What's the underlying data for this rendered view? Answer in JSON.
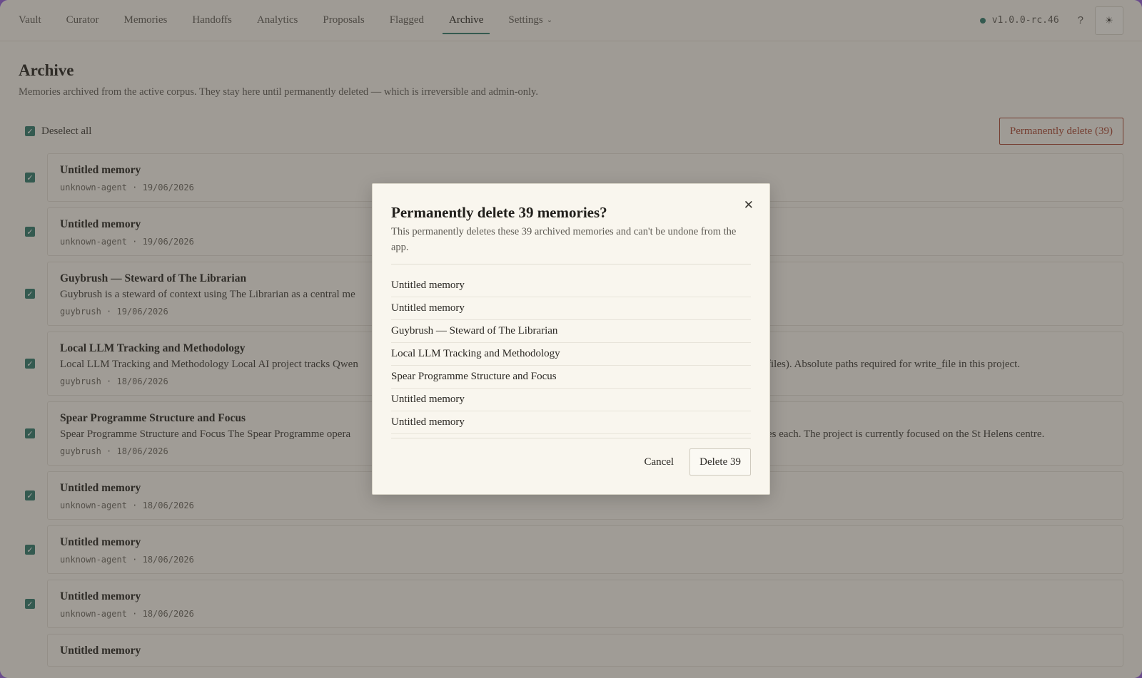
{
  "nav": {
    "tabs": [
      {
        "label": "Vault"
      },
      {
        "label": "Curator"
      },
      {
        "label": "Memories"
      },
      {
        "label": "Handoffs"
      },
      {
        "label": "Analytics"
      },
      {
        "label": "Proposals"
      },
      {
        "label": "Flagged"
      },
      {
        "label": "Archive",
        "active": true
      },
      {
        "label": "Settings",
        "has_dropdown": true
      }
    ],
    "version": "v1.0.0-rc.46",
    "help_label": "?",
    "theme_icon": "sun-icon",
    "status_color": "#2f7a6a"
  },
  "page": {
    "title": "Archive",
    "description": "Memories archived from the active corpus. They stay here until permanently deleted — which is irreversible and admin-only.",
    "deselect_label": "Deselect all",
    "perm_delete_label": "Permanently delete (39)"
  },
  "rows": [
    {
      "title": "Untitled memory",
      "body": "",
      "meta": "unknown-agent · 19/06/2026"
    },
    {
      "title": "Untitled memory",
      "body": "",
      "meta": "unknown-agent · 19/06/2026"
    },
    {
      "title": "Guybrush — Steward of The Librarian",
      "body": "Guybrush is a steward of context using The Librarian as a central me",
      "meta": "guybrush · 19/06/2026"
    },
    {
      "title": "Local LLM Tracking and Methodology",
      "body": "Local LLM Tracking and Methodology Local AI project tracks Qwen",
      "body_tail": "files). Absolute paths required for write_file in this project.",
      "meta": "guybrush · 18/06/2026"
    },
    {
      "title": "Spear Programme Structure and Focus",
      "body": "Spear Programme Structure and Focus The Spear Programme opera",
      "body_tail": "es each. The project is currently focused on the St Helens centre.",
      "meta": "guybrush · 18/06/2026"
    },
    {
      "title": "Untitled memory",
      "body": "",
      "meta": "unknown-agent · 18/06/2026"
    },
    {
      "title": "Untitled memory",
      "body": "",
      "meta": "unknown-agent · 18/06/2026"
    },
    {
      "title": "Untitled memory",
      "body": "",
      "meta": "unknown-agent · 18/06/2026"
    },
    {
      "title": "Untitled memory",
      "body": "",
      "meta": ""
    }
  ],
  "modal": {
    "title": "Permanently delete 39 memories?",
    "description": "This permanently deletes these 39 archived memories and can't be undone from the app.",
    "items": [
      "Untitled memory",
      "Untitled memory",
      "Guybrush — Steward of The Librarian",
      "Local LLM Tracking and Methodology",
      "Spear Programme Structure and Focus",
      "Untitled memory",
      "Untitled memory"
    ],
    "cancel_label": "Cancel",
    "delete_label": "Delete 39",
    "close_icon": "close-icon"
  }
}
